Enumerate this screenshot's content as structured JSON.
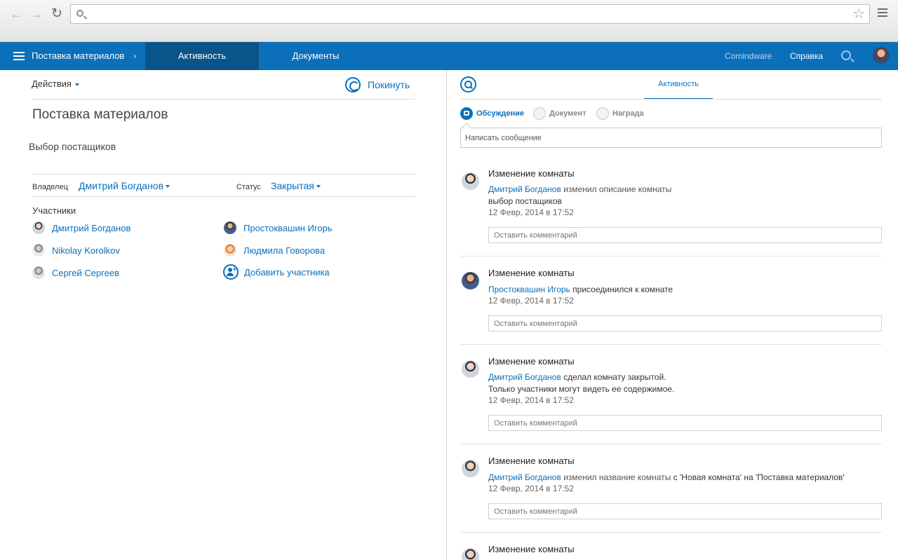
{
  "header": {
    "breadcrumb": "Поставка материалов",
    "crumb_separator": "›",
    "tabs": [
      {
        "label": "Активность",
        "active": true
      },
      {
        "label": "Документы",
        "active": false
      }
    ],
    "links": {
      "brand": "Comindware",
      "help": "Справка"
    }
  },
  "left": {
    "actions_label": "Действия",
    "leave_label": "Покинуть",
    "room_title": "Поставка материалов",
    "room_description": "Выбор постащиков",
    "owner_label": "Владелец",
    "owner_value": "Дмитрий Богданов",
    "status_label": "Статус",
    "status_value": "Закрытая",
    "members_heading": "Участники",
    "members": [
      {
        "name": "Дмитрий Богданов"
      },
      {
        "name": "Простоквашин Игорь"
      },
      {
        "name": "Nikolay Korolkov"
      },
      {
        "name": "Людмила Говорова"
      },
      {
        "name": "Сергей Сергеев"
      }
    ],
    "add_member_label": "Добавить участника"
  },
  "right": {
    "tab_label": "Активность",
    "subtabs": [
      {
        "label": "Обсуждение",
        "active": true
      },
      {
        "label": "Документ",
        "active": false
      },
      {
        "label": "Награда",
        "active": false
      }
    ],
    "message_placeholder": "Написать сообщение",
    "comment_placeholder": "Оставить комментарий",
    "entries": [
      {
        "title": "Изменение комнаты",
        "author": "Дмитрий Богданов",
        "action": "изменил описание комнаты",
        "detail": "выбор постащиков",
        "date": "12 Февр, 2014 в 17:52"
      },
      {
        "title": "Изменение комнаты",
        "author": "Простоквашин Игорь",
        "action": "присоединился к комнате",
        "date": "12 Февр, 2014 в 17:52"
      },
      {
        "title": "Изменение комнаты",
        "author": "Дмитрий Богданов",
        "action": "сделал комнату закрытой.",
        "detail": "Только участники могут видеть ее содержимое.",
        "date": "12 Февр, 2014 в 17:52"
      },
      {
        "title": "Изменение комнаты",
        "author": "Дмитрий Богданов",
        "action": "изменил название комнаты",
        "action_suffix": "с 'Новая комната' на 'Поставка материалов'",
        "date": "12 Февр, 2014 в 17:52"
      },
      {
        "title": "Изменение комнаты"
      }
    ]
  }
}
